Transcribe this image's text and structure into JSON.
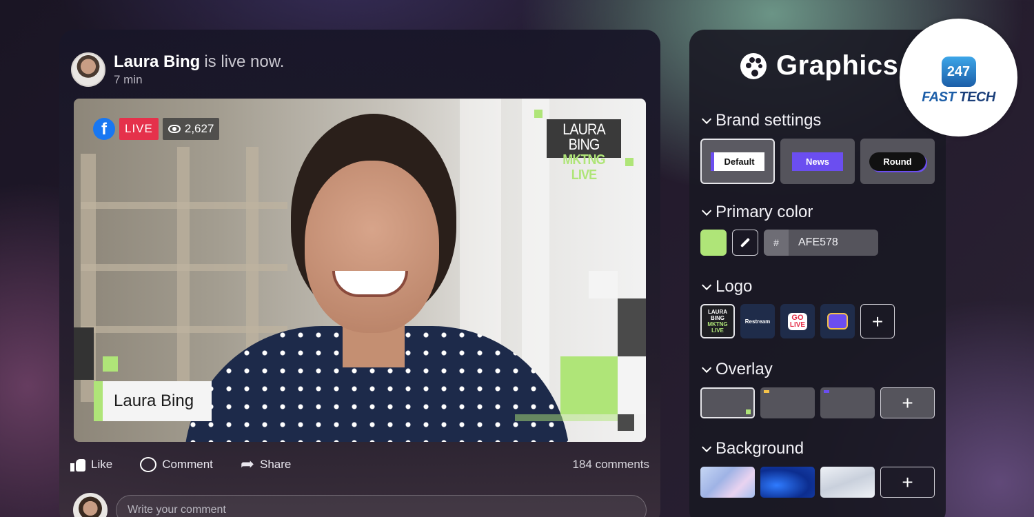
{
  "post": {
    "author": "Laura Bing",
    "status": "is live now.",
    "time": "7 min",
    "live_label": "LIVE",
    "viewers": "2,627",
    "brand_logo_line1": "LAURA BING",
    "brand_logo_line2": "MKTNG LIVE",
    "name_tag": "Laura Bing",
    "actions": {
      "like": "Like",
      "comment": "Comment",
      "share": "Share",
      "comments_count": "184 comments"
    },
    "comment_placeholder": "Write your comment"
  },
  "graphics": {
    "title": "Graphics",
    "sections": {
      "brand_settings": "Brand settings",
      "primary_color": "Primary color",
      "logo": "Logo",
      "overlay": "Overlay",
      "background": "Background"
    },
    "brand_cards": [
      "Default",
      "News",
      "Round"
    ],
    "primary_color": {
      "hash": "#",
      "value": "AFE578",
      "swatch": "#afe578"
    },
    "logos": {
      "first_line1": "LAURA BING",
      "first_line2": "MKTNG LIVE",
      "second": "Restream",
      "third_line1": "GO",
      "third_line2": "LIVE"
    },
    "add_label": "+"
  },
  "watermark": {
    "badge": "247",
    "text_a": "FAST",
    "text_b": " TECH"
  },
  "colors": {
    "accent_green": "#afe578",
    "accent_purple": "#6b4ef0",
    "live_red": "#e5314b",
    "facebook_blue": "#1877f2"
  }
}
